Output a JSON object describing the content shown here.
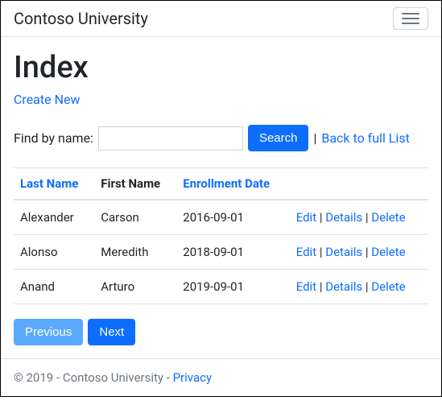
{
  "navbar": {
    "brand": "Contoso University"
  },
  "page": {
    "title": "Index",
    "create_new": "Create New",
    "search_label": "Find by name:",
    "search_value": "",
    "search_button": "Search",
    "back_to_list": "Back to full List"
  },
  "table": {
    "headers": {
      "last_name": "Last Name",
      "first_name": "First Name",
      "enrollment_date": "Enrollment Date"
    },
    "action_labels": {
      "edit": "Edit",
      "details": "Details",
      "delete": "Delete"
    },
    "rows": [
      {
        "last_name": "Alexander",
        "first_name": "Carson",
        "enrollment_date": "2016-09-01"
      },
      {
        "last_name": "Alonso",
        "first_name": "Meredith",
        "enrollment_date": "2018-09-01"
      },
      {
        "last_name": "Anand",
        "first_name": "Arturo",
        "enrollment_date": "2019-09-01"
      }
    ]
  },
  "pagination": {
    "previous": "Previous",
    "next": "Next"
  },
  "footer": {
    "text": "© 2019 - Contoso University - ",
    "privacy": "Privacy"
  }
}
